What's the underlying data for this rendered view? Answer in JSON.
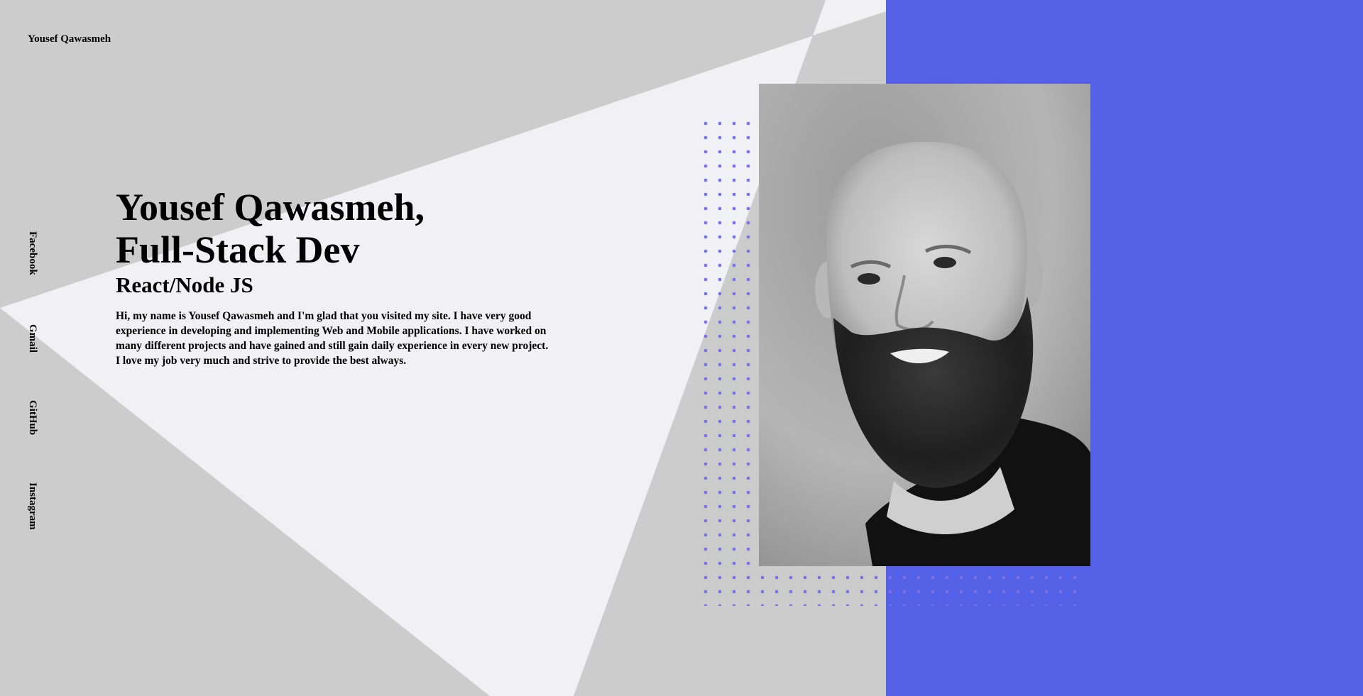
{
  "header": {
    "brand": "Yousef Qawasmeh"
  },
  "social": {
    "items": [
      {
        "label": "Facebook",
        "icon": "facebook-link"
      },
      {
        "label": "Gmail",
        "icon": "gmail-link"
      },
      {
        "label": "GitHub",
        "icon": "github-link"
      },
      {
        "label": "Instagram",
        "icon": "instagram-link"
      }
    ]
  },
  "hero": {
    "title_line1": "Yousef Qawasmeh,",
    "title_line2": "Full-Stack Dev",
    "subtitle": "React/Node JS",
    "intro": "Hi, my name is Yousef Qawasmeh and I'm glad that you visited my site. I have very good experience in developing and implementing Web and Mobile applications. I have worked on many different projects and have gained and still gain daily experience in every new project. I love my job very much and strive to provide the best always."
  },
  "photo": {
    "alt": "portrait-photo"
  },
  "colors": {
    "background_gray": "#cccccc",
    "light_triangle": "#f1f1f5",
    "accent_blue": "#5461e6",
    "dot_color": "#7a72e8"
  }
}
